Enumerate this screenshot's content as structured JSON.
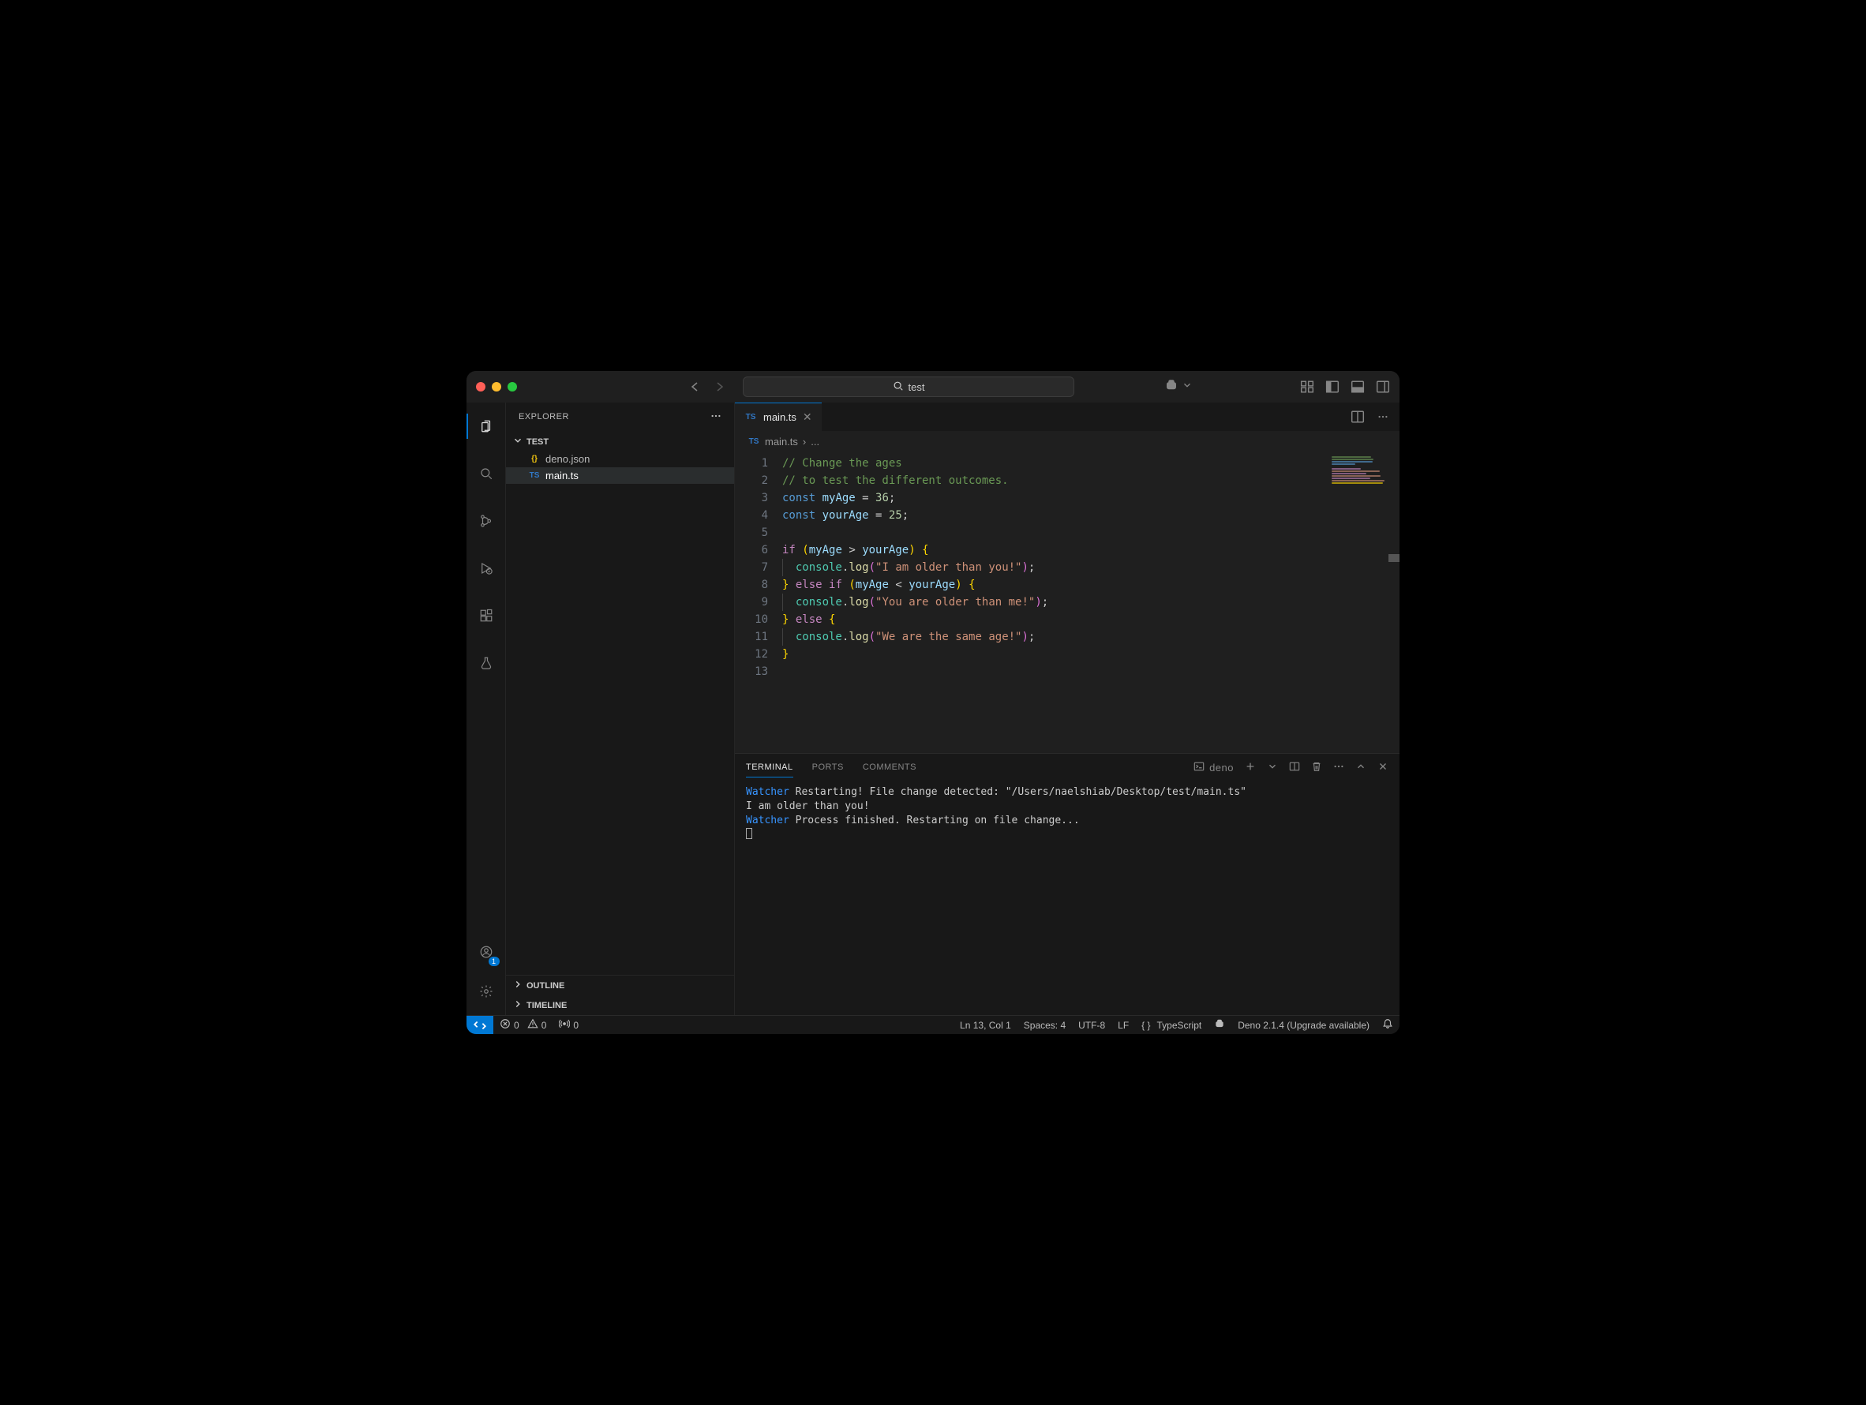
{
  "window": {
    "search_text": "test"
  },
  "sidebar": {
    "title": "EXPLORER",
    "folder": "TEST",
    "files": [
      {
        "name": "deno.json",
        "icon_label": "{}",
        "selected": false
      },
      {
        "name": "main.ts",
        "icon_label": "TS",
        "selected": true
      }
    ],
    "sections": {
      "outline": "OUTLINE",
      "timeline": "TIMELINE"
    }
  },
  "tabs": {
    "open": [
      {
        "name": "main.ts",
        "icon": "TS"
      }
    ]
  },
  "breadcrumb": {
    "icon": "TS",
    "file": "main.ts",
    "sep": "›",
    "tail": "..."
  },
  "editor": {
    "lines": [
      {
        "n": 1,
        "html": "<span class='cm'>// Change the ages</span>"
      },
      {
        "n": 2,
        "html": "<span class='cm'>// to test the different outcomes.</span>"
      },
      {
        "n": 3,
        "html": "<span class='kw'>const</span> <span class='var'>myAge</span> = <span class='num'>36</span>;"
      },
      {
        "n": 4,
        "html": "<span class='kw'>const</span> <span class='var'>yourAge</span> = <span class='num'>25</span>;"
      },
      {
        "n": 5,
        "html": ""
      },
      {
        "n": 6,
        "html": "<span class='kw2'>if</span> <span class='brace'>(</span><span class='var'>myAge</span> &gt; <span class='var'>yourAge</span><span class='brace'>)</span> <span class='brace'>{</span>"
      },
      {
        "n": 7,
        "html": "<span class='guide'></span>  <span class='obj'>console</span>.<span class='fn'>log</span><span class='brace2'>(</span><span class='str'>\"I am older than you!\"</span><span class='brace2'>)</span>;"
      },
      {
        "n": 8,
        "html": "<span class='brace'>}</span> <span class='kw2'>else</span> <span class='kw2'>if</span> <span class='brace'>(</span><span class='var'>myAge</span> &lt; <span class='var'>yourAge</span><span class='brace'>)</span> <span class='brace'>{</span>"
      },
      {
        "n": 9,
        "html": "<span class='guide'></span>  <span class='obj'>console</span>.<span class='fn'>log</span><span class='brace2'>(</span><span class='str'>\"You are older than me!\"</span><span class='brace2'>)</span>;"
      },
      {
        "n": 10,
        "html": "<span class='brace'>}</span> <span class='kw2'>else</span> <span class='brace'>{</span>"
      },
      {
        "n": 11,
        "html": "<span class='guide'></span>  <span class='obj'>console</span>.<span class='fn'>log</span><span class='brace2'>(</span><span class='str'>\"We are the same age!\"</span><span class='brace2'>)</span>;"
      },
      {
        "n": 12,
        "html": "<span class='brace'>}</span>"
      },
      {
        "n": 13,
        "html": ""
      }
    ]
  },
  "panel": {
    "tabs": {
      "terminal": "TERMINAL",
      "ports": "PORTS",
      "comments": "COMMENTS"
    },
    "shell_label": "deno",
    "terminal_lines": [
      {
        "html": "<span class='term-blue'>Watcher</span> Restarting! File change detected: \"/Users/naelshiab/Desktop/test/main.ts\""
      },
      {
        "html": "I am older than you!"
      },
      {
        "html": "<span class='term-blue'>Watcher</span> Process finished. Restarting on file change..."
      },
      {
        "html": "<span class='cursor-box'></span>"
      }
    ]
  },
  "status": {
    "errors": "0",
    "warnings": "0",
    "ports": "0",
    "cursor": "Ln 13, Col 1",
    "spaces": "Spaces: 4",
    "encoding": "UTF-8",
    "eol": "LF",
    "language": "TypeScript",
    "runtime": "Deno 2.1.4 (Upgrade available)"
  },
  "account_badge": "1"
}
